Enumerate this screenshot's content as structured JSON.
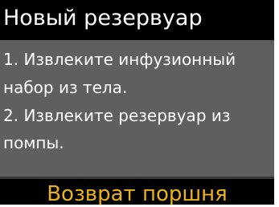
{
  "header": {
    "title": "Новый резервуар"
  },
  "instructions": {
    "lines": [
      "1. Извлеките инфузионный",
      "набор из тела.",
      "2. Извлеките резервуар из",
      "помпы."
    ]
  },
  "footer": {
    "action_label": "Возврат поршня"
  },
  "colors": {
    "background": "#000000",
    "panel": "#5f5f5f",
    "text": "#ffffff",
    "accent": "#e9b21a"
  }
}
